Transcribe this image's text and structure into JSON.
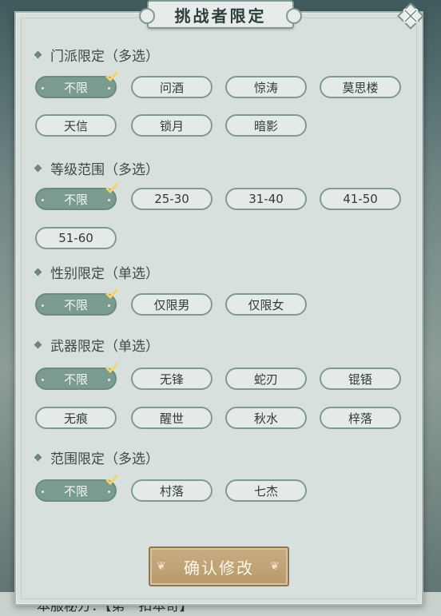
{
  "title": "挑战者限定",
  "sections": [
    {
      "label": "门派限定（多选）",
      "options": [
        "不限",
        "问酒",
        "惊涛",
        "莫思楼",
        "天信",
        "锁月",
        "暗影"
      ],
      "selected": 0
    },
    {
      "label": "等级范围（多选）",
      "options": [
        "不限",
        "25-30",
        "31-40",
        "41-50",
        "51-60"
      ],
      "selected": 0
    },
    {
      "label": "性别限定（单选）",
      "options": [
        "不限",
        "仅限男",
        "仅限女"
      ],
      "selected": 0
    },
    {
      "label": "武器限定（单选）",
      "options": [
        "不限",
        "无锋",
        "蛇刃",
        "锟铻",
        "无痕",
        "醒世",
        "秋水",
        "梓落"
      ],
      "selected": 0
    },
    {
      "label": "范围限定（多选）",
      "options": [
        "不限",
        "村落",
        "七杰"
      ],
      "selected": 0
    }
  ],
  "confirm_label": "确认修改",
  "backdrop_text": "本服秘方：【第一扣本奇】",
  "colors": {
    "accent": "#7b9b91",
    "button": "#c0a577"
  },
  "icons": {
    "close": "close-icon",
    "check": "check-icon"
  }
}
